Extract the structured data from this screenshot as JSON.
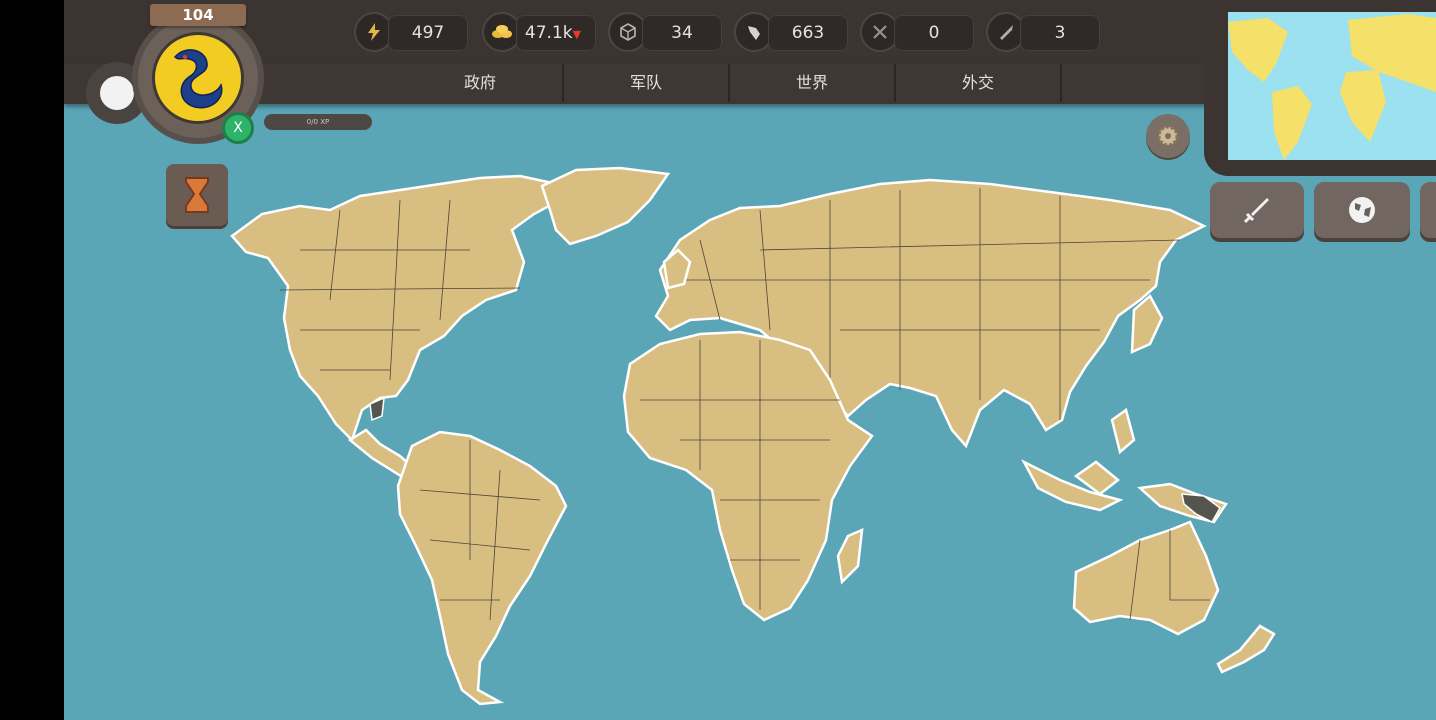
{
  "resources": [
    {
      "icon": "lightning-icon",
      "value": "497"
    },
    {
      "icon": "gold-coins-icon",
      "value": "47.1k",
      "trend": "down",
      "trend_color": "#e23b2e"
    },
    {
      "icon": "cube-icon",
      "value": "34"
    },
    {
      "icon": "fist-icon",
      "value": "663"
    },
    {
      "icon": "crossed-swords-icon",
      "value": "0"
    },
    {
      "icon": "bullet-icon",
      "value": "3"
    }
  ],
  "tabs": [
    {
      "label": "政府"
    },
    {
      "label": "军队"
    },
    {
      "label": "世界"
    },
    {
      "label": "外交"
    }
  ],
  "player": {
    "level": "104",
    "emblem": "dragon-flag-icon",
    "xp_label": "0/0 XP",
    "close_label": "X"
  },
  "colors": {
    "sea": "#5aa6b7",
    "land": "#d9be82",
    "selected_country": "#555550",
    "topbar": "#3b3431"
  },
  "side_buttons": [
    {
      "icon": "sword-icon"
    },
    {
      "icon": "globe-icon"
    }
  ]
}
